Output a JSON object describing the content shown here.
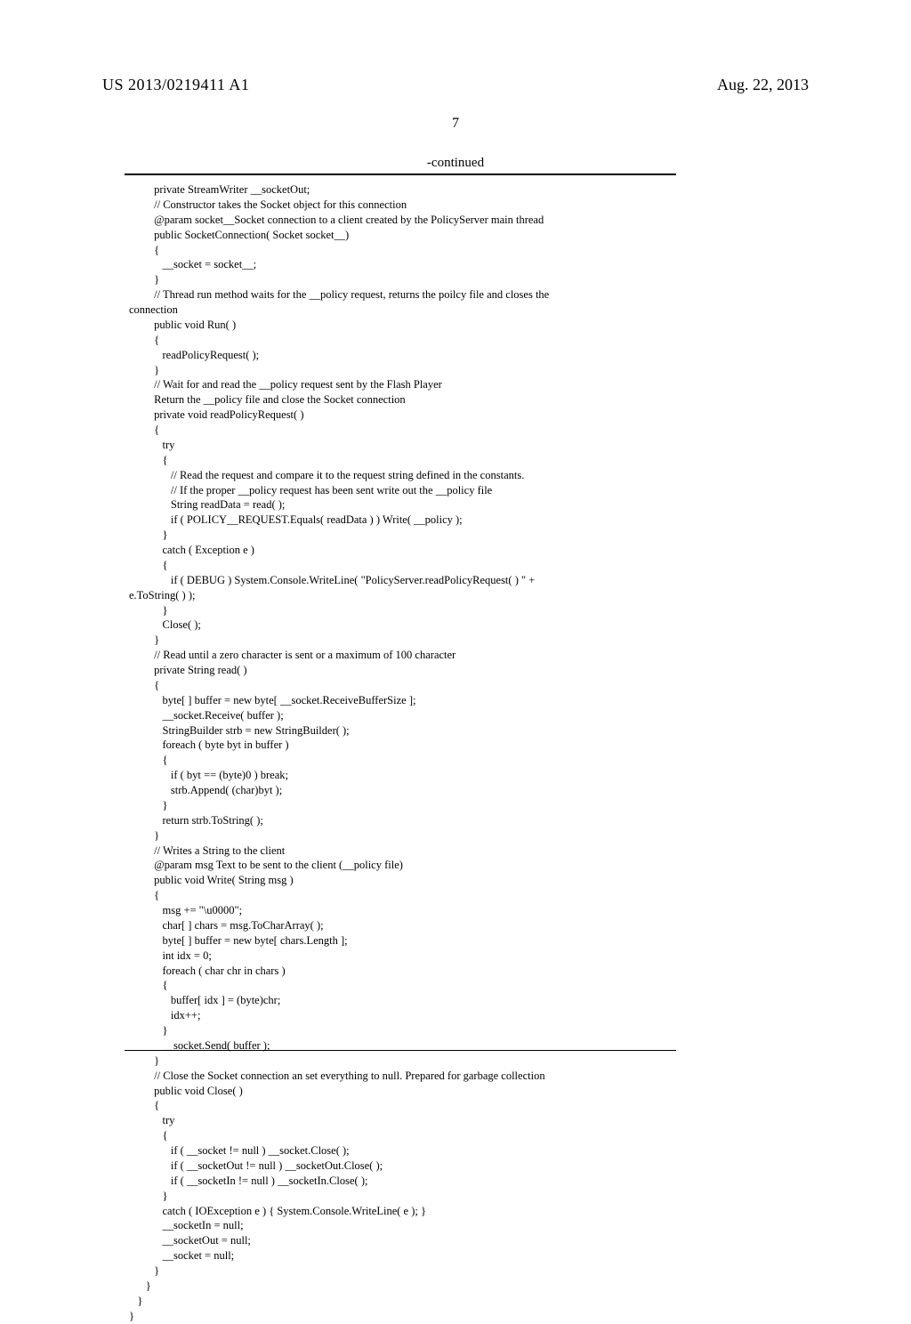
{
  "header": {
    "patent_no": "US 2013/0219411 A1",
    "date": "Aug. 22, 2013"
  },
  "page_number": "7",
  "continued_label": "-continued",
  "code": "         private StreamWriter __socketOut;\n         // Constructor takes the Socket object for this connection\n         @param socket__Socket connection to a client created by the PolicyServer main thread\n         public SocketConnection( Socket socket__)\n         {\n            __socket = socket__;\n         }\n         // Thread run method waits for the __policy request, returns the poilcy file and closes the\nconnection\n         public void Run( )\n         {\n            readPolicyRequest( );\n         }\n         // Wait for and read the __policy request sent by the Flash Player\n         Return the __policy file and close the Socket connection\n         private void readPolicyRequest( )\n         {\n            try\n            {\n               // Read the request and compare it to the request string defined in the constants.\n               // If the proper __policy request has been sent write out the __policy file\n               String readData = read( );\n               if ( POLICY__REQUEST.Equals( readData ) ) Write( __policy );\n            }\n            catch ( Exception e )\n            {\n               if ( DEBUG ) System.Console.WriteLine( \"PolicyServer.readPolicyRequest( ) \" +\ne.ToString( ) );\n            }\n            Close( );\n         }\n         // Read until a zero character is sent or a maximum of 100 character\n         private String read( )\n         {\n            byte[ ] buffer = new byte[ __socket.ReceiveBufferSize ];\n            __socket.Receive( buffer );\n            StringBuilder strb = new StringBuilder( );\n            foreach ( byte byt in buffer )\n            {\n               if ( byt == (byte)0 ) break;\n               strb.Append( (char)byt );\n            }\n            return strb.ToString( );\n         }\n         // Writes a String to the client\n         @param msg Text to be sent to the client (__policy file)\n         public void Write( String msg )\n         {\n            msg += \"\\u0000\";\n            char[ ] chars = msg.ToCharArray( );\n            byte[ ] buffer = new byte[ chars.Length ];\n            int idx = 0;\n            foreach ( char chr in chars )\n            {\n               buffer[ idx ] = (byte)chr;\n               idx++;\n            }\n            __socket.Send( buffer );\n         }\n         // Close the Socket connection an set everything to null. Prepared for garbage collection\n         public void Close( )\n         {\n            try\n            {\n               if ( __socket != null ) __socket.Close( );\n               if ( __socketOut != null ) __socketOut.Close( );\n               if ( __socketIn != null ) __socketIn.Close( );\n            }\n            catch ( IOException e ) { System.Console.WriteLine( e ); }\n            __socketIn = null;\n            __socketOut = null;\n            __socket = null;\n         }\n      }\n   }\n}"
}
